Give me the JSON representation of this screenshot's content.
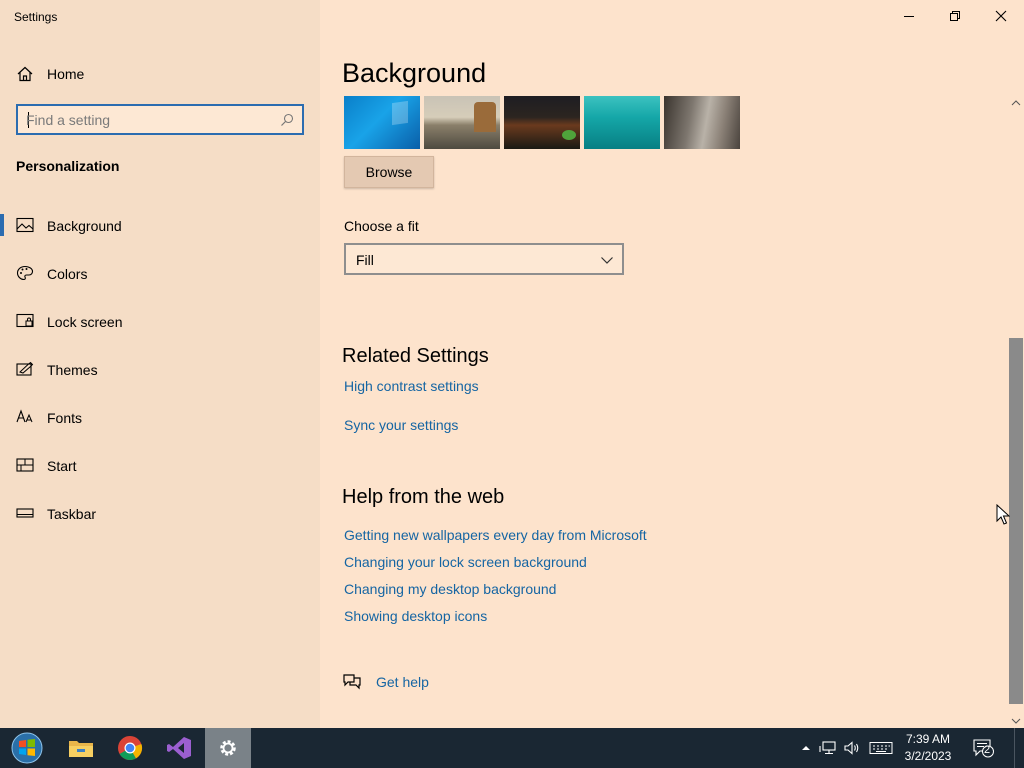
{
  "window": {
    "title": "Settings",
    "controls": {
      "minimize": "minimize",
      "restore": "restore",
      "close": "close"
    }
  },
  "sidebar": {
    "home_label": "Home",
    "search_placeholder": "Find a setting",
    "section_title": "Personalization",
    "items": [
      {
        "label": "Background",
        "icon": "image-icon",
        "active": true
      },
      {
        "label": "Colors",
        "icon": "palette-icon",
        "active": false
      },
      {
        "label": "Lock screen",
        "icon": "lock-screen-icon",
        "active": false
      },
      {
        "label": "Themes",
        "icon": "themes-icon",
        "active": false
      },
      {
        "label": "Fonts",
        "icon": "fonts-icon",
        "active": false
      },
      {
        "label": "Start",
        "icon": "start-icon",
        "active": false
      },
      {
        "label": "Taskbar",
        "icon": "taskbar-icon",
        "active": false
      }
    ]
  },
  "main": {
    "title": "Background",
    "browse_label": "Browse",
    "fit": {
      "label": "Choose a fit",
      "value": "Fill"
    },
    "related": {
      "title": "Related Settings",
      "links": [
        "High contrast settings",
        "Sync your settings"
      ]
    },
    "help": {
      "title": "Help from the web",
      "links": [
        "Getting new wallpapers every day from Microsoft",
        "Changing your lock screen background",
        "Changing my desktop background",
        "Showing desktop icons"
      ]
    },
    "get_help": "Get help"
  },
  "taskbar": {
    "time": "7:39 AM",
    "date": "3/2/2023",
    "notification_count": "2"
  },
  "colors": {
    "accent": "#2b6cb0",
    "link": "#1565a3",
    "sidebar_bg": "#f5ddc6",
    "main_bg": "#fde3cc",
    "taskbar_bg": "#1a2733"
  }
}
